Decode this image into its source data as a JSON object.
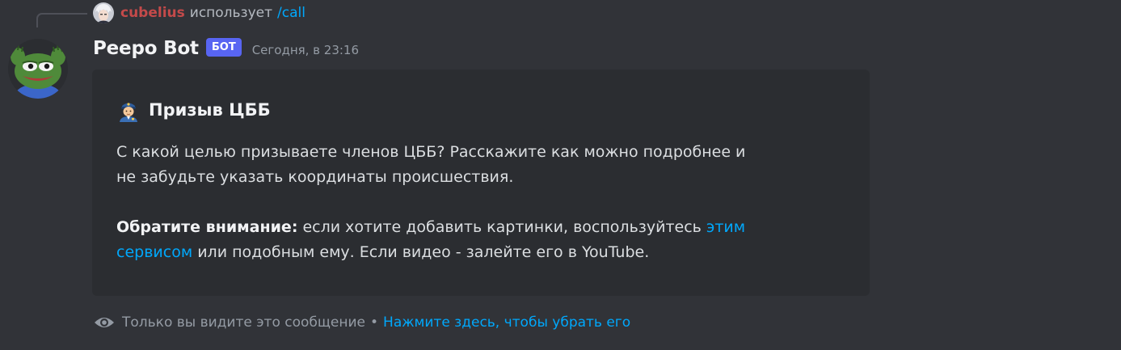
{
  "reply": {
    "username": "cubelius",
    "verb": "использует",
    "command": "/call"
  },
  "message": {
    "author": "Peepo Bot",
    "bot_tag": "БОТ",
    "timestamp": "Сегодня, в 23:16"
  },
  "embed": {
    "title_emoji": "police-officer-emoji",
    "title": "Призыв ЦББ",
    "description_line1": "С какой целью призываете членов ЦББ? Расскажите как можно подробнее и",
    "description_line2": "не забудьте указать координаты происшествия.",
    "notice_bold": "Обратите внимание:",
    "notice_text1": " если хотите добавить картинки, воспользуйтесь ",
    "notice_link_part1": "этим",
    "notice_link_part2": "сервисом",
    "notice_text2": " или подобным ему. Если видео - залейте его в YouTube."
  },
  "ephemeral": {
    "icon": "eye-icon",
    "text": "Только вы видите это сообщение",
    "separator": "•",
    "dismiss_link": "Нажмите здесь, чтобы убрать его"
  },
  "colors": {
    "background": "#313338",
    "embed_background": "#2b2d31",
    "link": "#00a8fc",
    "bot_tag": "#5865f2",
    "reply_username": "#c44a4a"
  }
}
